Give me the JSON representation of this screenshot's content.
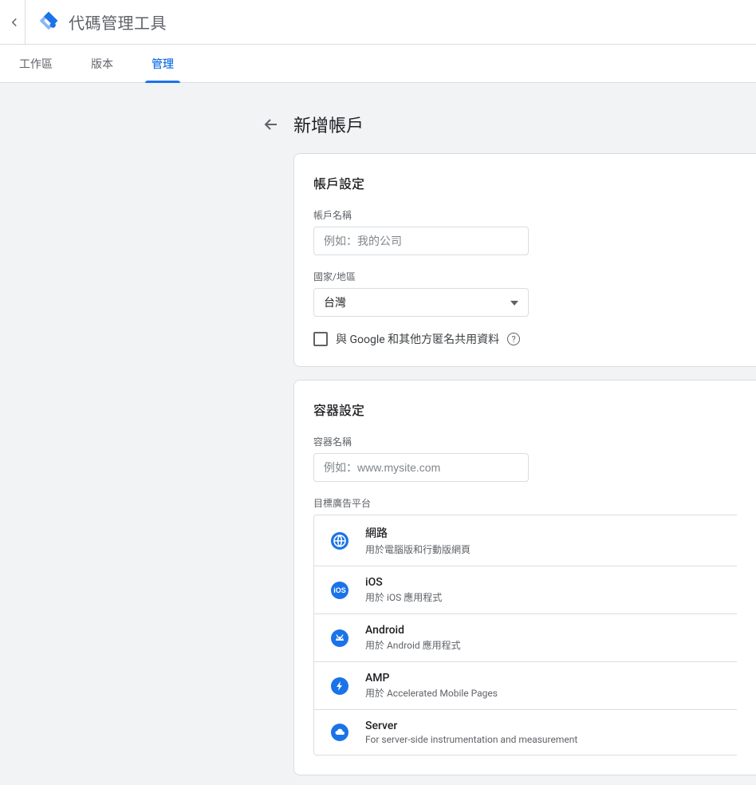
{
  "header": {
    "title": "代碼管理工具"
  },
  "tabs": {
    "workspace": "工作區",
    "versions": "版本",
    "admin": "管理"
  },
  "panel": {
    "title": "新增帳戶"
  },
  "account": {
    "section_title": "帳戶設定",
    "name_label": "帳戶名稱",
    "name_placeholder": "例如：我的公司",
    "country_label": "國家/地區",
    "country_value": "台灣",
    "share_checkbox_label": "與 Google 和其他方匿名共用資料"
  },
  "container": {
    "section_title": "容器設定",
    "name_label": "容器名稱",
    "name_placeholder": "例如：www.mysite.com",
    "platform_label": "目標廣告平台",
    "options": [
      {
        "title": "網路",
        "desc": "用於電腦版和行動版網頁"
      },
      {
        "title": "iOS",
        "desc": "用於 iOS 應用程式"
      },
      {
        "title": "Android",
        "desc": "用於 Android 應用程式"
      },
      {
        "title": "AMP",
        "desc": "用於 Accelerated Mobile Pages"
      },
      {
        "title": "Server",
        "desc": "For server-side instrumentation and measurement"
      }
    ]
  }
}
